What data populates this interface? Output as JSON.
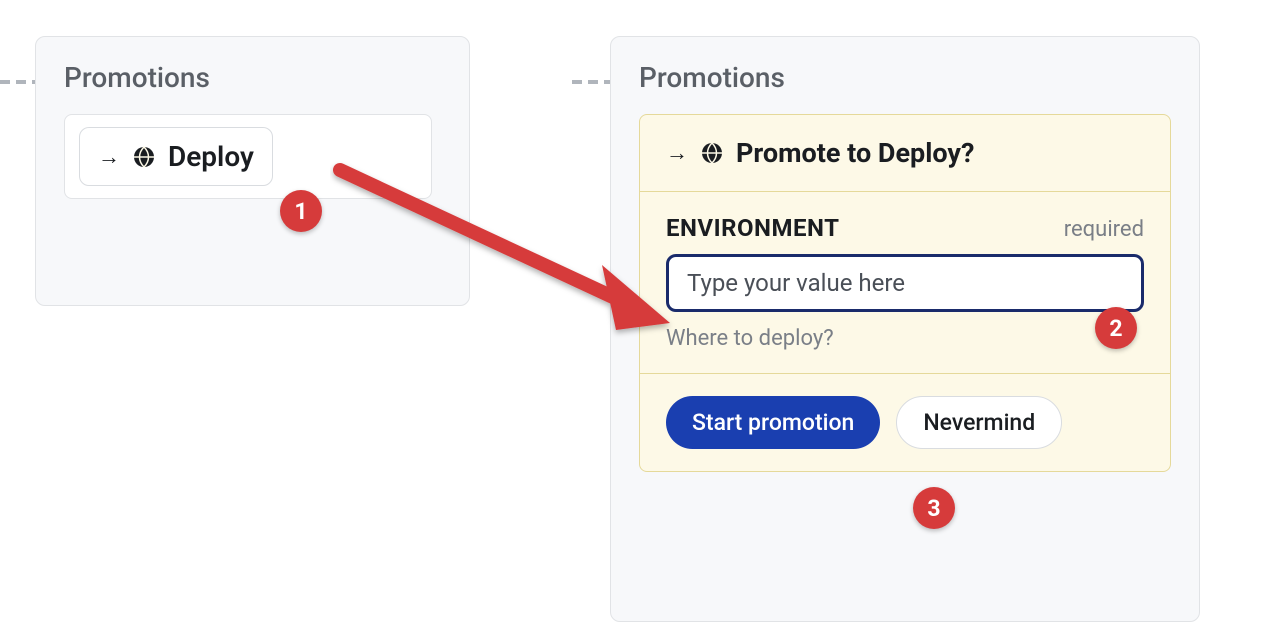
{
  "left": {
    "title": "Promotions",
    "deploy_label": "Deploy"
  },
  "right": {
    "title": "Promotions",
    "promote": {
      "header": "Promote to Deploy?",
      "field_label": "ENVIRONMENT",
      "required_label": "required",
      "input_placeholder": "Type your value here",
      "hint": "Where to deploy?",
      "start_button": "Start promotion",
      "cancel_button": "Nevermind"
    }
  },
  "annotations": {
    "badge1": "1",
    "badge2": "2",
    "badge3": "3"
  }
}
